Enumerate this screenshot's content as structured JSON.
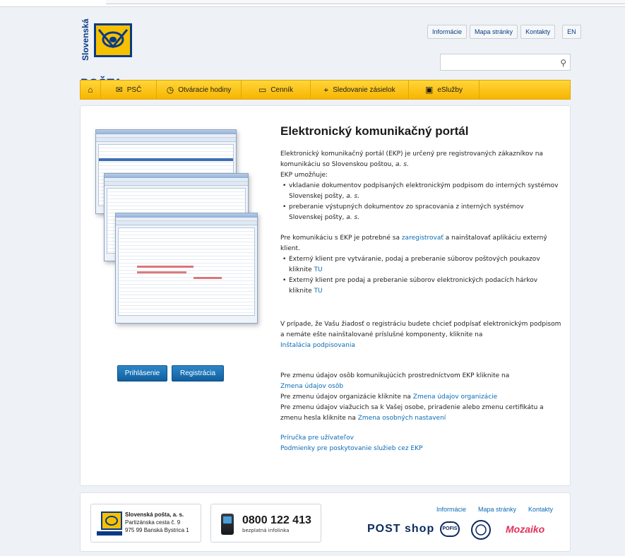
{
  "brand": {
    "vertical_text": "Slovenská",
    "name": "POŠTA",
    "colors": {
      "blue": "#0b3a85",
      "yellow": "#f7b500",
      "link": "#0a6bb5"
    }
  },
  "top_links": [
    "Informácie",
    "Mapa stránky",
    "Kontakty",
    "EN"
  ],
  "search": {
    "placeholder": "",
    "icon": "search-icon"
  },
  "nav": [
    {
      "label": "",
      "icon": "home-icon"
    },
    {
      "label": "PSČ",
      "icon": "envelope-search-icon"
    },
    {
      "label": "Otváracie hodiny",
      "icon": "clock-icon"
    },
    {
      "label": "Cenník",
      "icon": "price-tag-icon"
    },
    {
      "label": "Sledovanie zásielok",
      "icon": "location-pin-icon"
    },
    {
      "label": "eSlužby",
      "icon": "eservice-icon"
    }
  ],
  "main": {
    "title": "Elektronický komunikačný portál",
    "intro_line1": "Elektronický komunikačný portál (EKP) je určený pre registrovaných zákazníkov na",
    "intro_line2_pre": "komunikáciu so Slovenskou poštou, ",
    "intro_line2_italic": "a. s.",
    "enables": "EKP umožňuje:",
    "bullet1_line1": "vkladanie dokumentov podpísaných elektronickým podpisom do interných systémov",
    "bullet1_line2_pre": "Slovenskej pošty, ",
    "bullet1_line2_italic": "a. s.",
    "bullet2_line1": "preberanie výstupných dokumentov zo spracovania z interných systémov",
    "bullet2_line2_pre": "Slovenskej pošty, ",
    "bullet2_line2_italic": "a. s.",
    "reg_pre": "Pre komunikáciu s EKP je potrebné sa ",
    "reg_link": "zaregistrovať",
    "reg_post": " a nainštalovať aplikáciu externý",
    "reg_line2": "klient.",
    "client1_line1": "Externý klient pre vytváranie, podaj a preberanie súborov poštových poukazov",
    "client1_line2_pre": "kliknite ",
    "client1_link": "TU",
    "client2_line1": "Externý klient pre podaj a preberanie súborov elektronických podacích hárkov",
    "client2_line2_pre": "kliknite ",
    "client2_link": "TU",
    "sign_line1": "V prípade, že Vašu žiadosť o registráciu budete chcieť podpísať elektronickým podpisom",
    "sign_line2": "a nemáte ešte nainštalované príslušné komponenty, kliknite na",
    "sign_link": "Inštalácia podpisovania",
    "chg1": "Pre zmenu údajov osôb komunikujúcich prostredníctvom EKP kliknite na",
    "chg1_link": "Zmena údajov osôb",
    "chg2_pre": "Pre zmenu údajov organizácie kliknite na ",
    "chg2_link": "Zmena údajov organizácie",
    "chg3_line1": "Pre zmenu údajov viažucich sa k Vašej osobe, priradenie alebo zmenu certifikátu a",
    "chg3_line2_pre": "zmenu hesla kliknite na ",
    "chg3_link": "Zmena osobných nastavení",
    "manual_link": "Príručka pre užívateľov",
    "terms_link": "Podmienky pre poskytovanie služieb cez EKP",
    "login_button": "Prihlásenie",
    "register_button": "Registrácia"
  },
  "footer": {
    "company": "Slovenská pošta, a. s.",
    "street": "Partizánska cesta č. 9",
    "city": "975 99 Banská Bystrica 1",
    "phone": "0800 122 413",
    "phone_sub": "bezplatná infolinka",
    "links": [
      "Informácie",
      "Mapa stránky",
      "Kontakty"
    ],
    "partners": [
      "POST shop",
      "POFIS",
      "emblem",
      "Mozaiko"
    ]
  }
}
